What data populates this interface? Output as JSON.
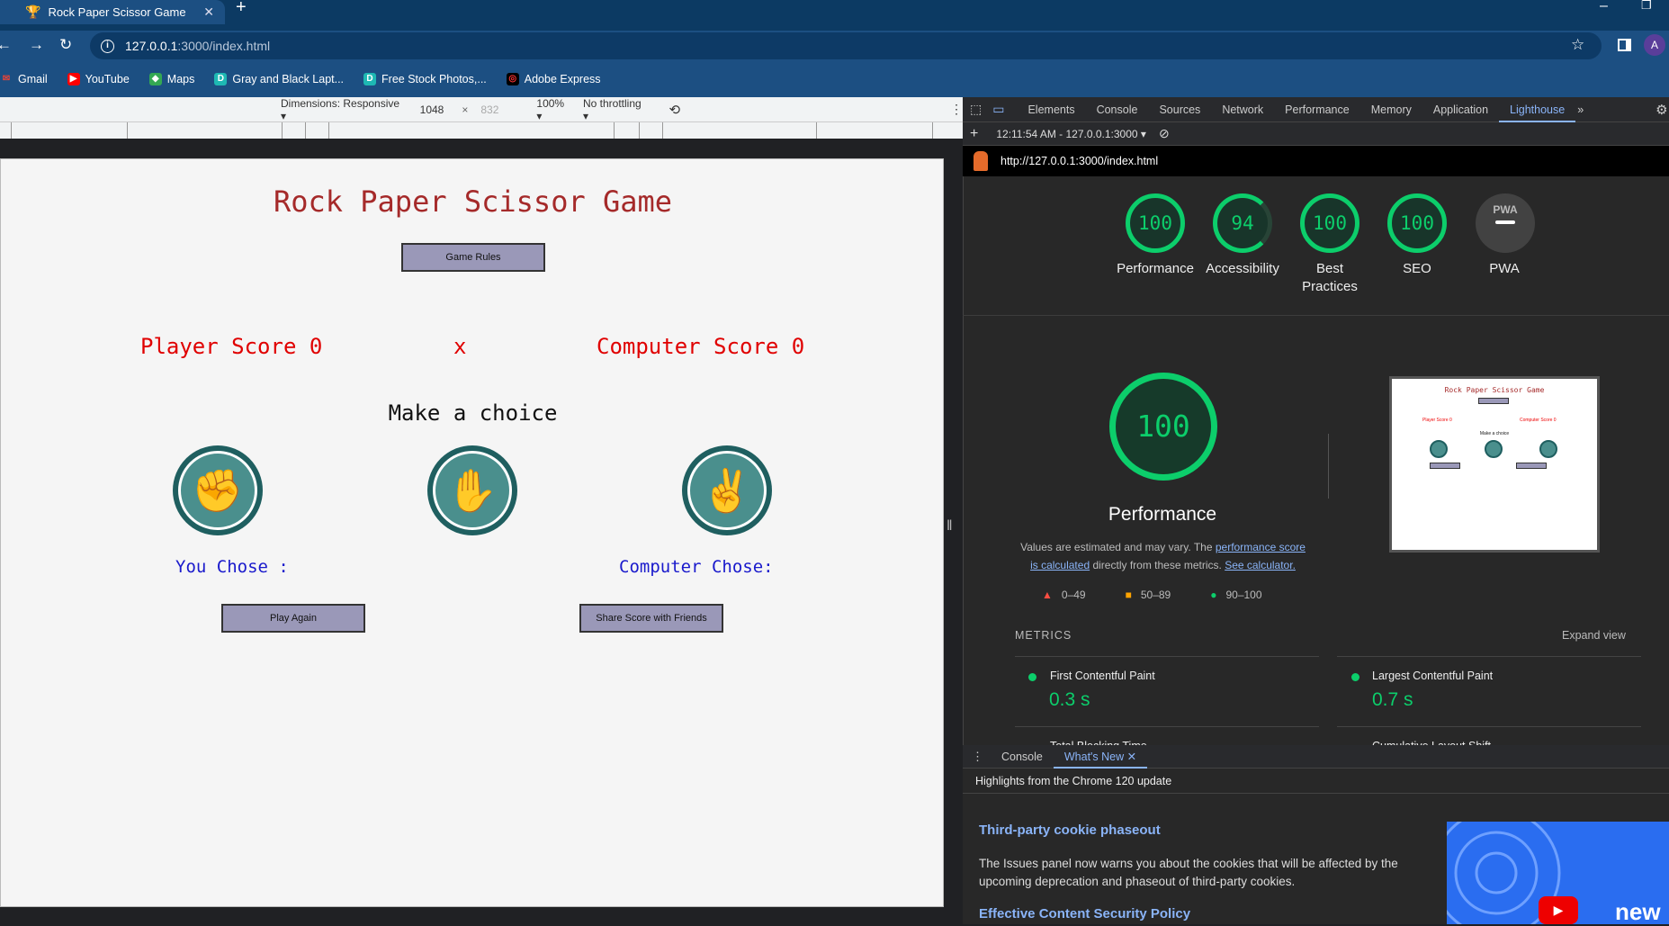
{
  "browser": {
    "tab_title": "Rock Paper Scissor Game",
    "url_host": "127.0.0.1",
    "url_path": ":3000/index.html",
    "bookmarks": [
      {
        "label": "Gmail",
        "icon": "gmail-icon"
      },
      {
        "label": "YouTube",
        "icon": "youtube-icon"
      },
      {
        "label": "Maps",
        "icon": "maps-icon"
      },
      {
        "label": "Gray and Black Lapt...",
        "icon": "document-icon"
      },
      {
        "label": "Free Stock Photos,...",
        "icon": "document-icon"
      },
      {
        "label": "Adobe Express",
        "icon": "adobe-icon"
      }
    ],
    "profile_initial": "A"
  },
  "device_toolbar": {
    "dimensions": "Dimensions: Responsive",
    "width": "1048",
    "times": "×",
    "height": "832",
    "zoom": "100%",
    "throttling": "No throttling"
  },
  "game": {
    "title": "Rock Paper Scissor Game",
    "rules_button": "Game Rules",
    "player_score": "Player Score 0",
    "versus": "x",
    "computer_score": "Computer Score 0",
    "make_choice": "Make a choice",
    "choices": [
      "rock",
      "paper",
      "scissors"
    ],
    "you_chose": "You Chose :",
    "computer_chose": "Computer Chose:",
    "play_again": "Play Again",
    "share": "Share Score with Friends"
  },
  "devtools": {
    "tabs": [
      "Elements",
      "Console",
      "Sources",
      "Network",
      "Performance",
      "Memory",
      "Application",
      "Lighthouse"
    ],
    "active_tab": "Lighthouse",
    "report_time": "12:11:54 AM - 127.0.0.1:3000",
    "report_url": "http://127.0.0.1:3000/index.html",
    "scores": [
      {
        "value": "100",
        "label": "Performance"
      },
      {
        "value": "94",
        "label": "Accessibility"
      },
      {
        "value": "100",
        "label": "Best Practices"
      },
      {
        "value": "100",
        "label": "SEO"
      }
    ],
    "pwa_label": "PWA",
    "pwa_badge": "PWA",
    "main_score": "100",
    "main_label": "Performance",
    "note_prefix": "Values are estimated and may vary. The",
    "note_link1": "performance score is calculated",
    "note_mid": "directly from these metrics.",
    "note_link2": "See calculator.",
    "legend": [
      "0–49",
      "50–89",
      "90–100"
    ],
    "metrics_label": "METRICS",
    "expand_view": "Expand view",
    "metrics": [
      {
        "name": "First Contentful Paint",
        "value": "0.3 s"
      },
      {
        "name": "Largest Contentful Paint",
        "value": "0.7 s"
      },
      {
        "name": "Total Blocking Time",
        "value": ""
      },
      {
        "name": "Cumulative Layout Shift",
        "value": ""
      }
    ],
    "status_colors": {
      "pass": "#0cce6b",
      "average": "#ffa400",
      "fail": "#ff4e42"
    }
  },
  "drawer": {
    "tabs": [
      "Console",
      "What's New"
    ],
    "active_tab": "What's New",
    "highlights": "Highlights from the Chrome 120 update",
    "heading1": "Third-party cookie phaseout",
    "paragraph1": "The Issues panel now warns you about the cookies that will be affected by the upcoming deprecation and phaseout of third-party cookies.",
    "heading2": "Effective Content Security Policy",
    "video_text": "new"
  }
}
